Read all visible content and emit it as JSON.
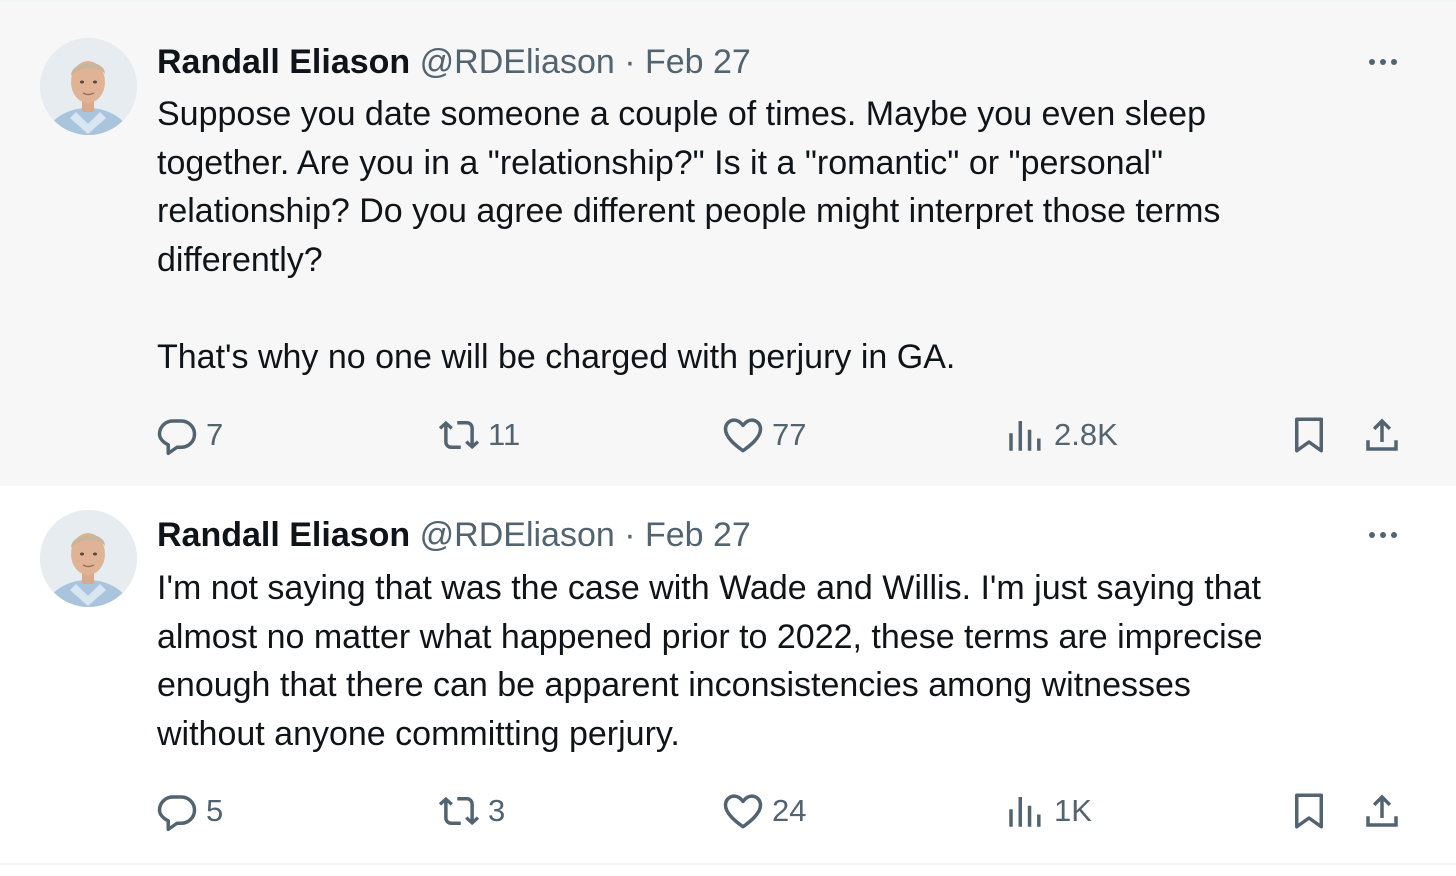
{
  "colors": {
    "text": "#0f1419",
    "secondary": "#536471",
    "thread_line": "#cfd9de",
    "highlight_bg": "#f7f7f7"
  },
  "tweets": [
    {
      "author_name": "Randall Eliason",
      "handle_date": "@RDEliason · Feb 27",
      "text": "Suppose you date someone a couple of times. Maybe you even sleep\ntogether. Are you in a \"relationship?\" Is it a \"romantic\" or \"personal\"\nrelationship? Do you agree different people might interpret those terms\ndifferently?\n\nThat's why no one will be charged with perjury in GA.",
      "replies": "7",
      "reposts": "11",
      "likes": "77",
      "views": "2.8K",
      "icons": [
        "reply-icon",
        "repost-icon",
        "like-icon",
        "views-icon",
        "bookmark-icon",
        "share-icon",
        "more-icon"
      ]
    },
    {
      "author_name": "Randall Eliason",
      "handle_date": "@RDEliason · Feb 27",
      "text": "I'm not saying that was the case with Wade and Willis. I'm just saying that\nalmost no matter what happened prior to 2022, these terms are imprecise\nenough that there can be apparent inconsistencies among witnesses\nwithout anyone committing perjury.",
      "replies": "5",
      "reposts": "3",
      "likes": "24",
      "views": "1K",
      "icons": [
        "reply-icon",
        "repost-icon",
        "like-icon",
        "views-icon",
        "bookmark-icon",
        "share-icon",
        "more-icon"
      ]
    }
  ]
}
